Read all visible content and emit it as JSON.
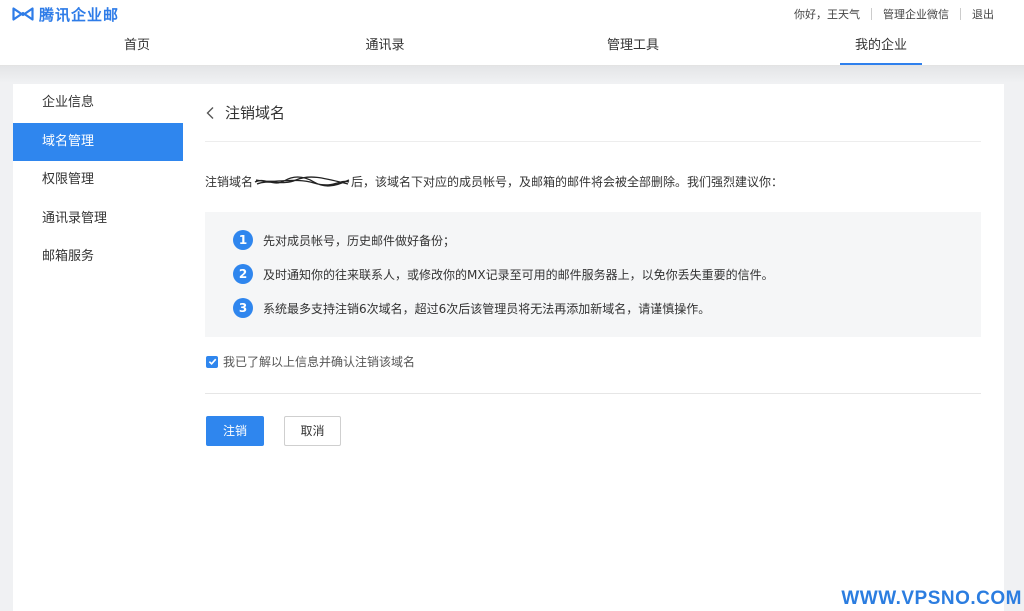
{
  "brand": {
    "name": "腾讯企业邮"
  },
  "top_links": {
    "greeting": "你好，王天气",
    "manage_wechat": "管理企业微信",
    "logout": "退出"
  },
  "nav": {
    "tabs": [
      "首页",
      "通讯录",
      "管理工具",
      "我的企业"
    ],
    "active": "我的企业"
  },
  "sidebar": {
    "items": [
      "企业信息",
      "域名管理",
      "权限管理",
      "通讯录管理",
      "邮箱服务"
    ],
    "active": "域名管理"
  },
  "page": {
    "title": "注销域名",
    "warning_prefix": "注销域名",
    "warning_suffix": "后，该域名下对应的成员帐号，及邮箱的邮件将会被全部删除。我们强烈建议你：",
    "tips": [
      {
        "num": "1",
        "text": "先对成员帐号，历史邮件做好备份；"
      },
      {
        "num": "2",
        "text": "及时通知你的往来联系人，或修改你的MX记录至可用的邮件服务器上，以免你丢失重要的信件。"
      },
      {
        "num": "3",
        "text": "系统最多支持注销6次域名，超过6次后该管理员将无法再添加新域名，请谨慎操作。"
      }
    ],
    "confirm_label": "我已了解以上信息并确认注销该域名",
    "confirm_checked": true,
    "primary_button": "注销",
    "cancel_button": "取消"
  },
  "watermark": "WWW.VPSNO.COM",
  "colors": {
    "accent": "#2f86ee",
    "brand": "#2e7ce8",
    "watermark": "#2b7de0"
  }
}
